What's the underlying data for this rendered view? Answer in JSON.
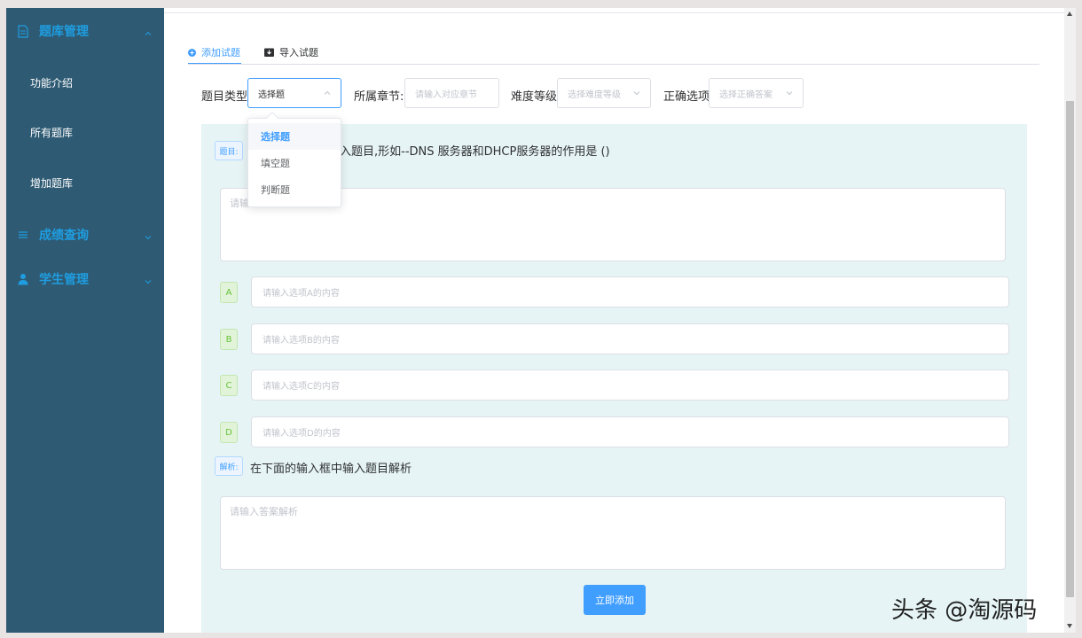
{
  "sidebar": {
    "groups": [
      {
        "label": "题库管理",
        "icon": "document-icon",
        "expanded": true
      },
      {
        "label": "成绩查询",
        "icon": "list-icon",
        "expanded": false
      },
      {
        "label": "学生管理",
        "icon": "user-icon",
        "expanded": false
      }
    ],
    "items": [
      {
        "label": "功能介绍"
      },
      {
        "label": "所有题库"
      },
      {
        "label": "增加题库"
      }
    ]
  },
  "tabs": {
    "add": "添加试题",
    "import": "导入试题"
  },
  "filters": {
    "type_label": "题目类型:",
    "type_value": "选择题",
    "chapter_label": "所属章节:",
    "chapter_placeholder": "请输入对应章节",
    "difficulty_label": "难度等级:",
    "difficulty_placeholder": "选择难度等级",
    "answer_label": "正确选项:",
    "answer_placeholder": "选择正确答案"
  },
  "dropdown": {
    "options": [
      "选择题",
      "填空题",
      "判断题"
    ],
    "selected": "选择题"
  },
  "question": {
    "tag": "题目:",
    "hint": "入题目,形如--DNS 服务器和DHCP服务器的作用是 ()",
    "placeholder": "请输"
  },
  "options": [
    {
      "letter": "A",
      "placeholder": "请输入选项A的内容"
    },
    {
      "letter": "B",
      "placeholder": "请输入选项B的内容"
    },
    {
      "letter": "C",
      "placeholder": "请输入选项C的内容"
    },
    {
      "letter": "D",
      "placeholder": "请输入选项D的内容"
    }
  ],
  "analysis": {
    "tag": "解析:",
    "hint": "在下面的输入框中输入题目解析",
    "placeholder": "请输入答案解析"
  },
  "submit_label": "立即添加",
  "watermark": "头条 @淘源码",
  "colors": {
    "sidebar_bg": "#2e5a73",
    "sidebar_accent": "#1f9de0",
    "primary": "#409eff",
    "panel_bg": "#e6f4f5",
    "option_badge": "#67c23a"
  }
}
